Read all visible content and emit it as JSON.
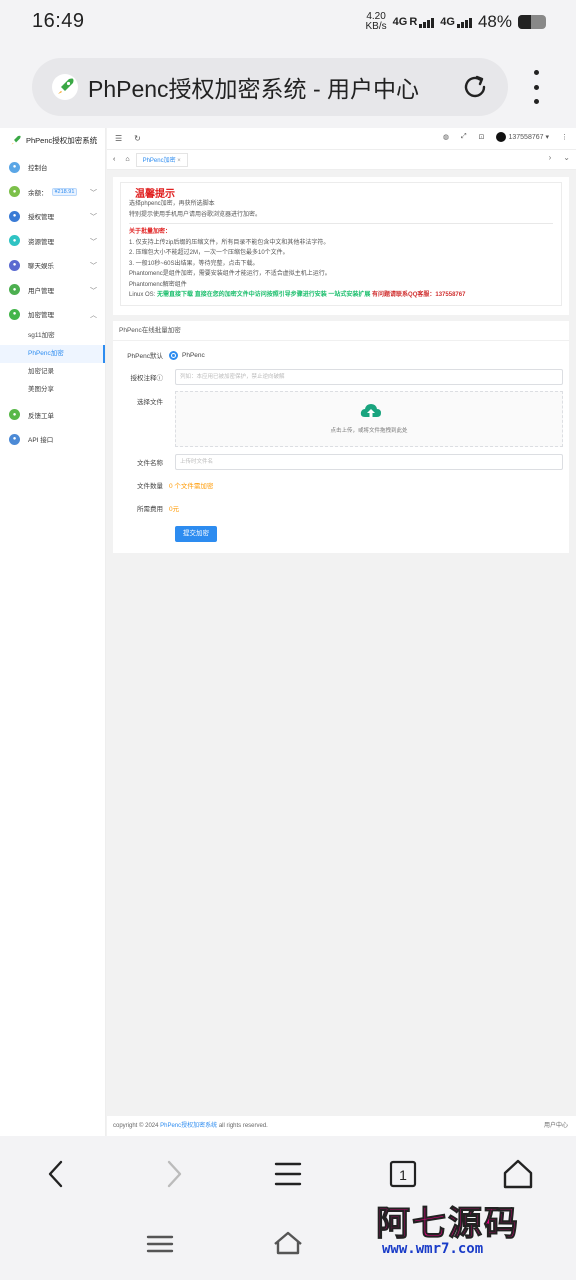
{
  "status": {
    "time": "16:49",
    "speed_value": "4.20",
    "speed_unit": "KB/s",
    "net1": "4G",
    "r_mark": "R",
    "net2": "4G",
    "battery": "48%",
    "battery_level": 0.48
  },
  "browser": {
    "page_title": "PhPenc授权加密系统 - 用户中心",
    "reload_icon": "reload-icon",
    "menu_icon": "more-vertical-icon"
  },
  "sidebar": {
    "brand": "PhPenc授权加密系统",
    "items": [
      {
        "label": "控制台",
        "icon": "dashboard-icon",
        "color": "#5aa6e6"
      },
      {
        "label": "余额：",
        "badge": "¥218.91",
        "icon": "wallet-icon",
        "color": "#7cc04a",
        "expandable": true
      },
      {
        "label": "授权管理",
        "icon": "key-icon",
        "color": "#3a7bd5",
        "expandable": true
      },
      {
        "label": "资源管理",
        "icon": "folder-icon",
        "color": "#2fc3c3",
        "expandable": true
      },
      {
        "label": "聊天娱乐",
        "icon": "chat-icon",
        "color": "#5b6ad0",
        "expandable": true
      },
      {
        "label": "用户管理",
        "icon": "user-icon",
        "color": "#4caf50",
        "expandable": true
      },
      {
        "label": "加密管理",
        "icon": "lock-icon",
        "color": "#43b54a",
        "expandable": true,
        "expanded": true
      }
    ],
    "sub_items": [
      {
        "label": "sg11加密"
      },
      {
        "label": "PhPenc加密",
        "active": true
      },
      {
        "label": "加密记录"
      },
      {
        "label": "美图分享"
      }
    ],
    "bottom_items": [
      {
        "label": "反馈工单",
        "icon": "ticket-icon",
        "color": "#58b848"
      },
      {
        "label": "API 接口",
        "icon": "api-icon",
        "color": "#4c8ad6"
      }
    ]
  },
  "topbar": {
    "username": "1375587​67"
  },
  "tabs": {
    "active": "PhPenc加密"
  },
  "notice": {
    "title": "温馨提示",
    "line1": "选择phpenc加密，再获所选脚本",
    "line2": "特别提示使用手机用户请用谷歌浏览器进行加密。",
    "section": "关于批量加密：",
    "rule1": "1. 仅支持上传zip后缀的压缩文件，所有目录不能包含中文和其他非法字符。",
    "rule2": "2. 压缩包大小不能超过2M，一次一个压缩包最多10个文件。",
    "rule3": "3. 一般10秒~60S出结果，等待完整，点击下载。",
    "line3": "Phantomenc是组件加密，需要安装组件才能运行，不适合虚拟主机上运行。",
    "line4": "Phantomenc解密组件",
    "linux_label": "Linux OS:",
    "linux_text": "无需直接下载 直接在您的加密文件中访问按照引导步骤进行安装 一站式安装扩展",
    "contact": "有问题请联系QQ客服：137558767"
  },
  "form": {
    "header": "PhPenc在线批量加密",
    "default_label": "PhPenc默认",
    "default_option": "PhPenc",
    "note_label": "授权注释",
    "note_placeholder": "列如：本应用已被加密保护，禁止逆向破解",
    "file_label": "选择文件",
    "upload_text": "点击上传，或将文件拖拽到此处",
    "filename_label": "文件名称",
    "filename_placeholder": "上传时文件名",
    "count_label": "文件数量",
    "count_value": "0 个文件需加密",
    "cost_label": "所需费用",
    "cost_value": "0元",
    "submit": "提交加密"
  },
  "footer": {
    "copyright_prefix": "copyright © 2024",
    "brand_link": "PhPenc授权加密系统",
    "rights": "all rights reserved.",
    "right_text": "用户中心"
  },
  "watermark": {
    "cn": "阿七源码",
    "url": "www.wmr7.com"
  }
}
